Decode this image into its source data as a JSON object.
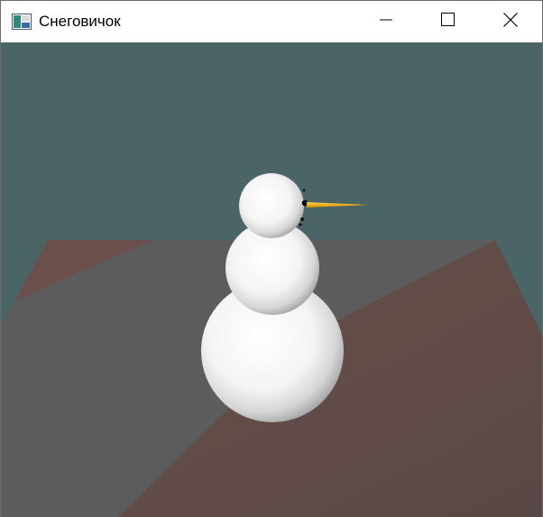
{
  "window": {
    "title": "Снеговичок",
    "icon": "app-window-icon",
    "controls": {
      "minimize_icon": "minimize-icon",
      "maximize_icon": "maximize-icon",
      "close_icon": "close-icon"
    }
  },
  "scene": {
    "background_color": "#4b6466",
    "table_color": "#5e4a47",
    "table_shadow_color": "#5d5c5c",
    "snow_color": "#ffffff",
    "eye_color": "#000000",
    "nose_color": "#f2b400"
  }
}
